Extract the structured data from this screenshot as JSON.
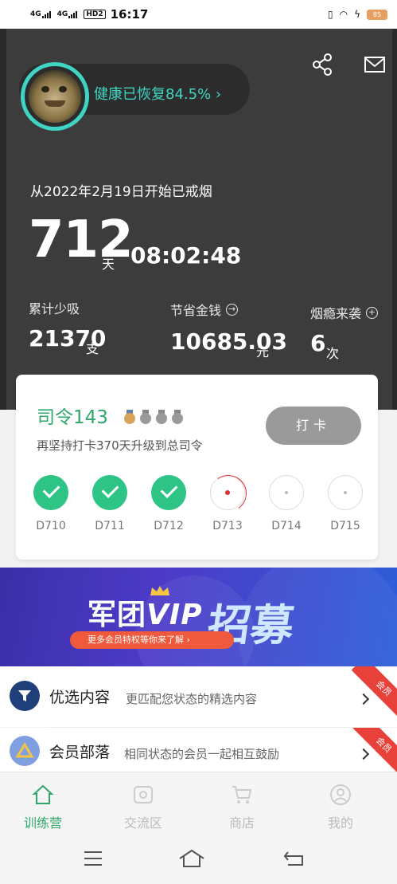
{
  "status_bar": {
    "signal1": "4G",
    "signal2": "4G",
    "hd": "HD2",
    "time": "16:17",
    "battery": "85"
  },
  "header": {
    "health": "健康已恢复84.5% ›",
    "since_text": "从2022年2月19日开始已戒烟",
    "days": "712",
    "days_unit": "天",
    "timer": "08:02:48",
    "stats": {
      "less_smoked": {
        "label": "累计少吸",
        "value": "21370",
        "unit": "支"
      },
      "money_saved": {
        "label": "节省金钱",
        "value": "10685.03",
        "unit": "元",
        "icon": "→"
      },
      "cravings": {
        "label": "烟瘾来袭",
        "value": "6",
        "unit": "次",
        "icon": "+"
      }
    }
  },
  "rank_card": {
    "rank": "司令143",
    "subtitle": "再坚持打卡370天升级到总司令",
    "checkin_label": "打卡",
    "days": [
      {
        "label": "D710",
        "state": "done"
      },
      {
        "label": "D711",
        "state": "done"
      },
      {
        "label": "D712",
        "state": "done"
      },
      {
        "label": "D713",
        "state": "current"
      },
      {
        "label": "D714",
        "state": "future"
      },
      {
        "label": "D715",
        "state": "future"
      }
    ]
  },
  "banner": {
    "title_left": "军团",
    "title_vip": "VIP",
    "title_right": "招募",
    "pill": "更多会员特权等你来了解  ›"
  },
  "list": [
    {
      "title": "优选内容",
      "subtitle": "更匹配您状态的精选内容",
      "ribbon": "会员",
      "icon": "filter-icon",
      "icon_color": "#1f3f7a"
    },
    {
      "title": "会员部落",
      "subtitle": "相同状态的会员一起相互鼓励",
      "ribbon": "会员",
      "icon": "triangle-icon",
      "icon_color": "#7f9fe0"
    }
  ],
  "bottom_nav": [
    {
      "label": "训练营",
      "icon": "home-icon",
      "active": true
    },
    {
      "label": "交流区",
      "icon": "camera-icon",
      "active": false
    },
    {
      "label": "商店",
      "icon": "cart-icon",
      "active": false
    },
    {
      "label": "我的",
      "icon": "user-icon",
      "active": false
    }
  ],
  "colors": {
    "accent_green": "#2ea86a",
    "health_teal": "#3fd4c4",
    "ribbon_red": "#e8413a",
    "header_bg": "#3c3c3c"
  }
}
